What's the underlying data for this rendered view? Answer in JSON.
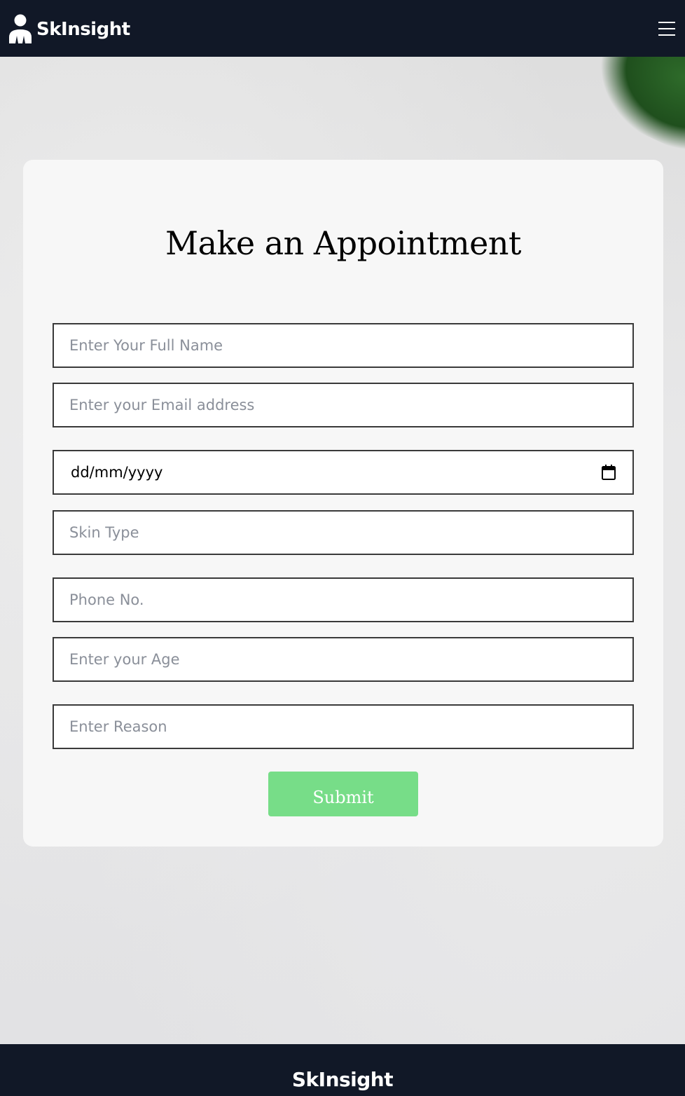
{
  "header": {
    "brand_name": "SkInsight",
    "logo_icon": "person-icon",
    "menu_icon": "hamburger-menu-icon"
  },
  "form": {
    "title": "Make an Appointment",
    "full_name_placeholder": "Enter Your Full Name",
    "email_placeholder": "Enter your Email address",
    "date_value": "dd/mm/yyyy",
    "date_icon": "calendar-icon",
    "skin_type_placeholder": "Skin Type",
    "phone_placeholder": "Phone No.",
    "age_placeholder": "Enter your Age",
    "reason_placeholder": "Enter Reason",
    "submit_label": "Submit"
  },
  "footer": {
    "brand_name": "SkInsight"
  },
  "colors": {
    "nav_background": "#111827",
    "submit_background": "#77dd88",
    "card_background": "#f7f7f7",
    "field_border": "#3a3a3a"
  }
}
